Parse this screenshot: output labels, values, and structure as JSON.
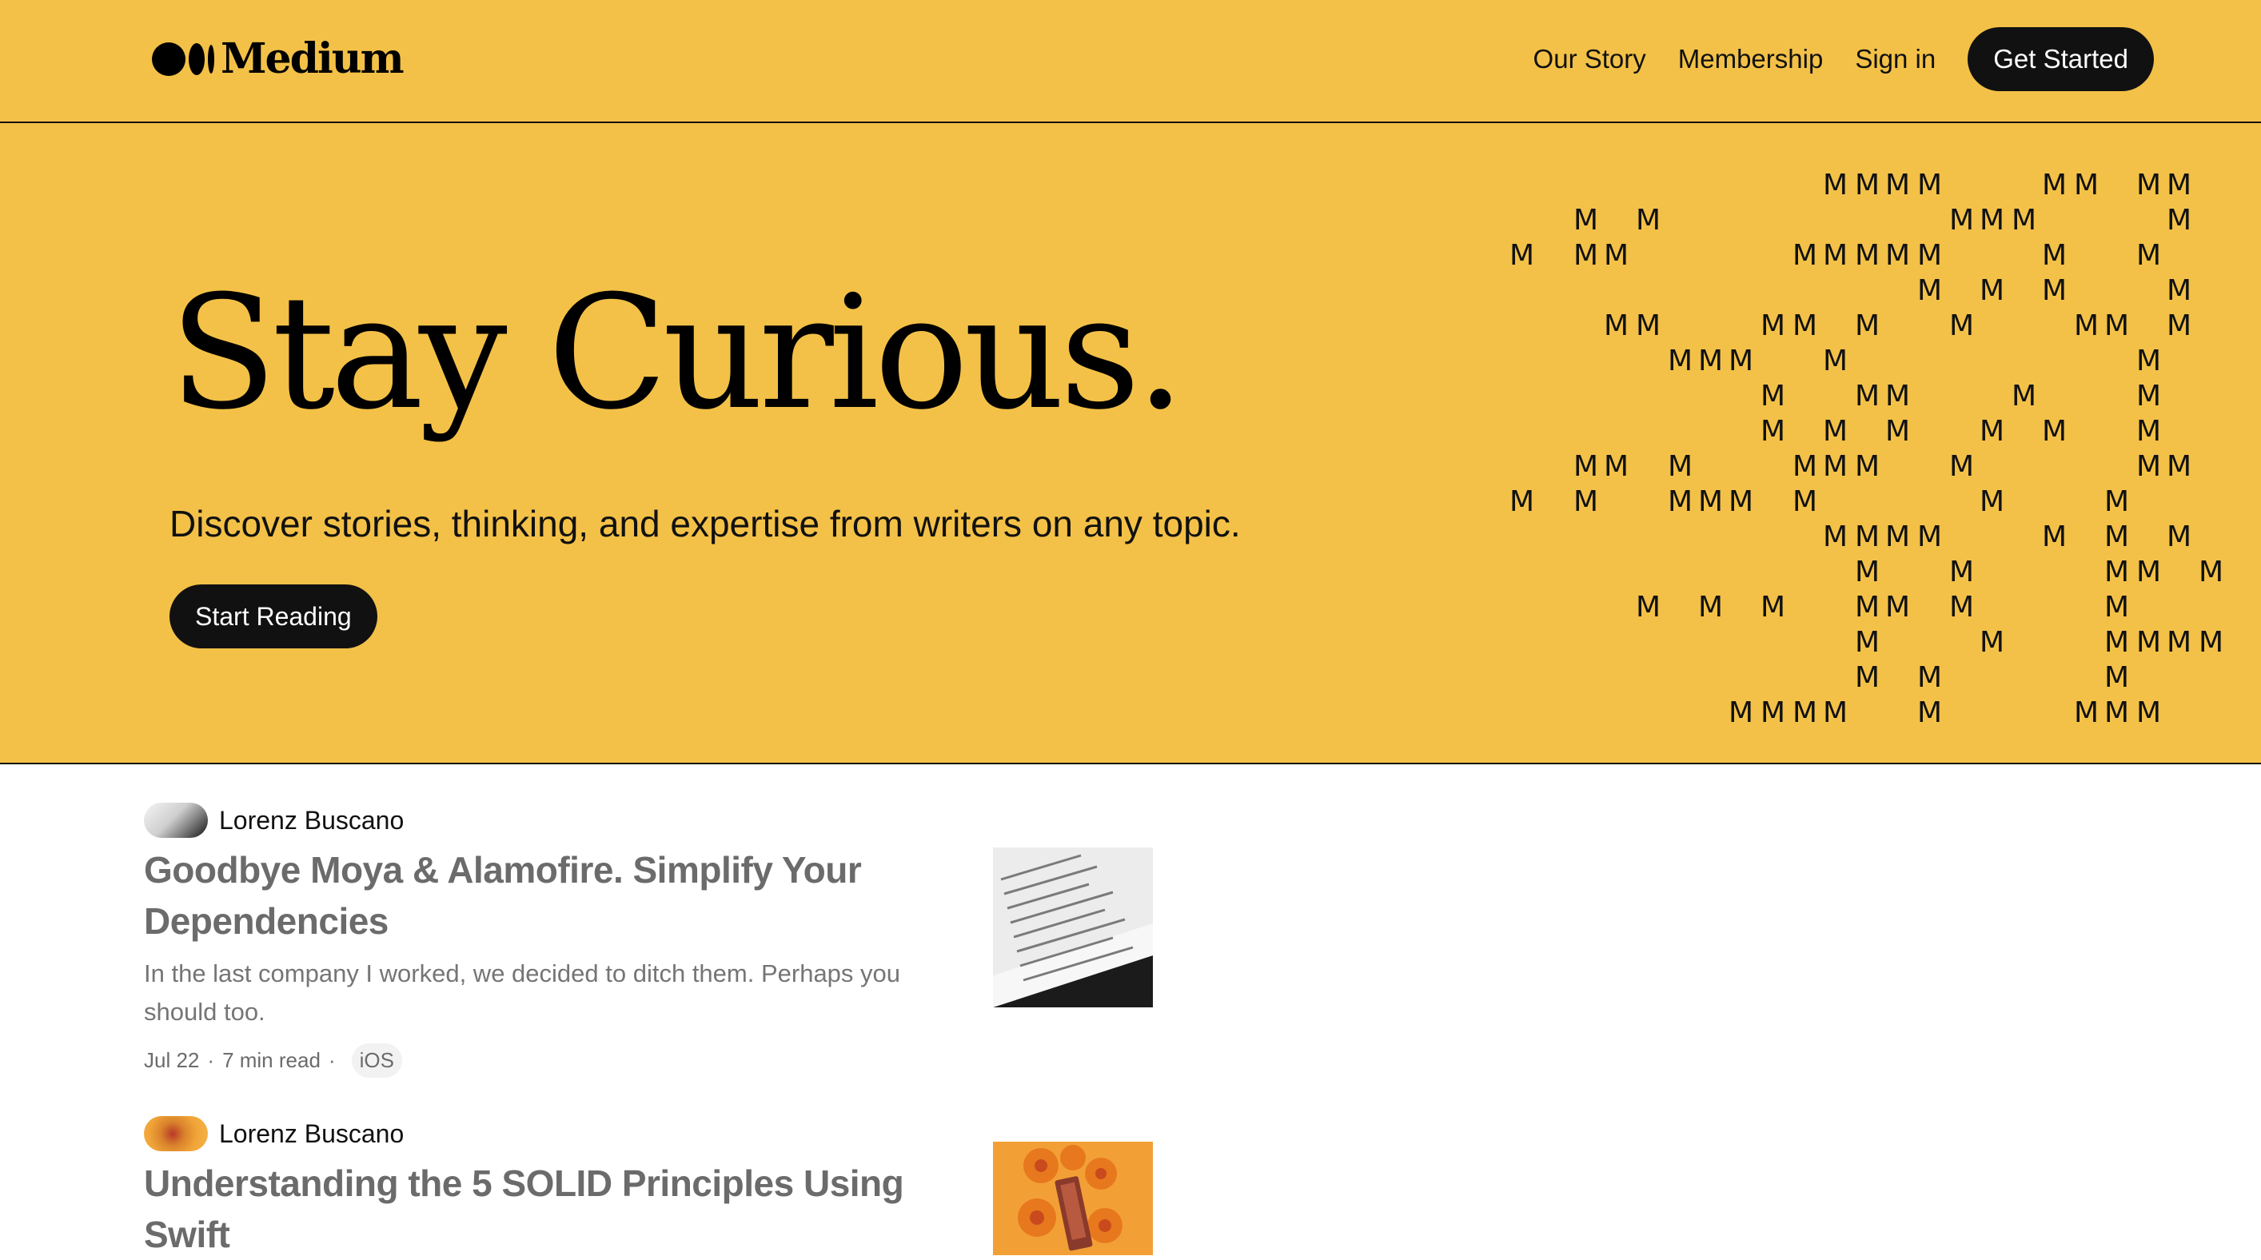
{
  "header": {
    "logo_text": "Medium",
    "nav": {
      "our_story": "Our Story",
      "membership": "Membership",
      "sign_in": "Sign in",
      "get_started": "Get Started"
    }
  },
  "hero": {
    "title": "Stay Curious.",
    "subtitle": "Discover stories, thinking, and expertise from writers on any topic.",
    "cta_label": "Start Reading",
    "decoration_glyph": "M",
    "colors": {
      "background": "#f3c147",
      "text": "#111111"
    }
  },
  "feed": {
    "posts": [
      {
        "author": "Lorenz Buscano",
        "title": "Goodbye Moya & Alamofire. Simplify Your Dependencies",
        "excerpt": "In the last company I worked, we decided to ditch them. Perhaps you should too.",
        "date": "Jul 22",
        "read_time": "7 min read",
        "tag": "iOS"
      },
      {
        "author": "Lorenz Buscano",
        "title": "Understanding the 5 SOLID Principles Using Swift"
      }
    ]
  }
}
